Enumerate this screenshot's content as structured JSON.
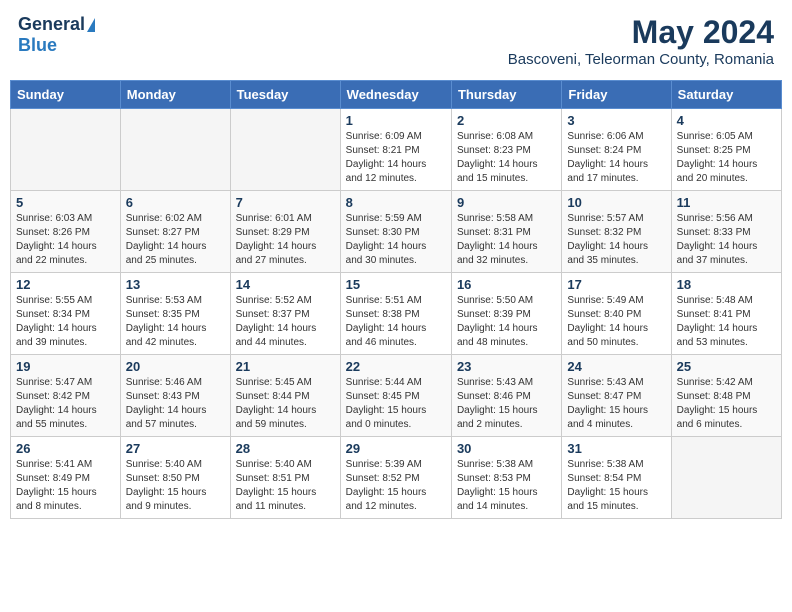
{
  "logo": {
    "general": "General",
    "blue": "Blue"
  },
  "title": "May 2024",
  "location": "Bascoveni, Teleorman County, Romania",
  "days_of_week": [
    "Sunday",
    "Monday",
    "Tuesday",
    "Wednesday",
    "Thursday",
    "Friday",
    "Saturday"
  ],
  "weeks": [
    [
      {
        "day": "",
        "info": ""
      },
      {
        "day": "",
        "info": ""
      },
      {
        "day": "",
        "info": ""
      },
      {
        "day": "1",
        "info": "Sunrise: 6:09 AM\nSunset: 8:21 PM\nDaylight: 14 hours\nand 12 minutes."
      },
      {
        "day": "2",
        "info": "Sunrise: 6:08 AM\nSunset: 8:23 PM\nDaylight: 14 hours\nand 15 minutes."
      },
      {
        "day": "3",
        "info": "Sunrise: 6:06 AM\nSunset: 8:24 PM\nDaylight: 14 hours\nand 17 minutes."
      },
      {
        "day": "4",
        "info": "Sunrise: 6:05 AM\nSunset: 8:25 PM\nDaylight: 14 hours\nand 20 minutes."
      }
    ],
    [
      {
        "day": "5",
        "info": "Sunrise: 6:03 AM\nSunset: 8:26 PM\nDaylight: 14 hours\nand 22 minutes."
      },
      {
        "day": "6",
        "info": "Sunrise: 6:02 AM\nSunset: 8:27 PM\nDaylight: 14 hours\nand 25 minutes."
      },
      {
        "day": "7",
        "info": "Sunrise: 6:01 AM\nSunset: 8:29 PM\nDaylight: 14 hours\nand 27 minutes."
      },
      {
        "day": "8",
        "info": "Sunrise: 5:59 AM\nSunset: 8:30 PM\nDaylight: 14 hours\nand 30 minutes."
      },
      {
        "day": "9",
        "info": "Sunrise: 5:58 AM\nSunset: 8:31 PM\nDaylight: 14 hours\nand 32 minutes."
      },
      {
        "day": "10",
        "info": "Sunrise: 5:57 AM\nSunset: 8:32 PM\nDaylight: 14 hours\nand 35 minutes."
      },
      {
        "day": "11",
        "info": "Sunrise: 5:56 AM\nSunset: 8:33 PM\nDaylight: 14 hours\nand 37 minutes."
      }
    ],
    [
      {
        "day": "12",
        "info": "Sunrise: 5:55 AM\nSunset: 8:34 PM\nDaylight: 14 hours\nand 39 minutes."
      },
      {
        "day": "13",
        "info": "Sunrise: 5:53 AM\nSunset: 8:35 PM\nDaylight: 14 hours\nand 42 minutes."
      },
      {
        "day": "14",
        "info": "Sunrise: 5:52 AM\nSunset: 8:37 PM\nDaylight: 14 hours\nand 44 minutes."
      },
      {
        "day": "15",
        "info": "Sunrise: 5:51 AM\nSunset: 8:38 PM\nDaylight: 14 hours\nand 46 minutes."
      },
      {
        "day": "16",
        "info": "Sunrise: 5:50 AM\nSunset: 8:39 PM\nDaylight: 14 hours\nand 48 minutes."
      },
      {
        "day": "17",
        "info": "Sunrise: 5:49 AM\nSunset: 8:40 PM\nDaylight: 14 hours\nand 50 minutes."
      },
      {
        "day": "18",
        "info": "Sunrise: 5:48 AM\nSunset: 8:41 PM\nDaylight: 14 hours\nand 53 minutes."
      }
    ],
    [
      {
        "day": "19",
        "info": "Sunrise: 5:47 AM\nSunset: 8:42 PM\nDaylight: 14 hours\nand 55 minutes."
      },
      {
        "day": "20",
        "info": "Sunrise: 5:46 AM\nSunset: 8:43 PM\nDaylight: 14 hours\nand 57 minutes."
      },
      {
        "day": "21",
        "info": "Sunrise: 5:45 AM\nSunset: 8:44 PM\nDaylight: 14 hours\nand 59 minutes."
      },
      {
        "day": "22",
        "info": "Sunrise: 5:44 AM\nSunset: 8:45 PM\nDaylight: 15 hours\nand 0 minutes."
      },
      {
        "day": "23",
        "info": "Sunrise: 5:43 AM\nSunset: 8:46 PM\nDaylight: 15 hours\nand 2 minutes."
      },
      {
        "day": "24",
        "info": "Sunrise: 5:43 AM\nSunset: 8:47 PM\nDaylight: 15 hours\nand 4 minutes."
      },
      {
        "day": "25",
        "info": "Sunrise: 5:42 AM\nSunset: 8:48 PM\nDaylight: 15 hours\nand 6 minutes."
      }
    ],
    [
      {
        "day": "26",
        "info": "Sunrise: 5:41 AM\nSunset: 8:49 PM\nDaylight: 15 hours\nand 8 minutes."
      },
      {
        "day": "27",
        "info": "Sunrise: 5:40 AM\nSunset: 8:50 PM\nDaylight: 15 hours\nand 9 minutes."
      },
      {
        "day": "28",
        "info": "Sunrise: 5:40 AM\nSunset: 8:51 PM\nDaylight: 15 hours\nand 11 minutes."
      },
      {
        "day": "29",
        "info": "Sunrise: 5:39 AM\nSunset: 8:52 PM\nDaylight: 15 hours\nand 12 minutes."
      },
      {
        "day": "30",
        "info": "Sunrise: 5:38 AM\nSunset: 8:53 PM\nDaylight: 15 hours\nand 14 minutes."
      },
      {
        "day": "31",
        "info": "Sunrise: 5:38 AM\nSunset: 8:54 PM\nDaylight: 15 hours\nand 15 minutes."
      },
      {
        "day": "",
        "info": ""
      }
    ]
  ]
}
